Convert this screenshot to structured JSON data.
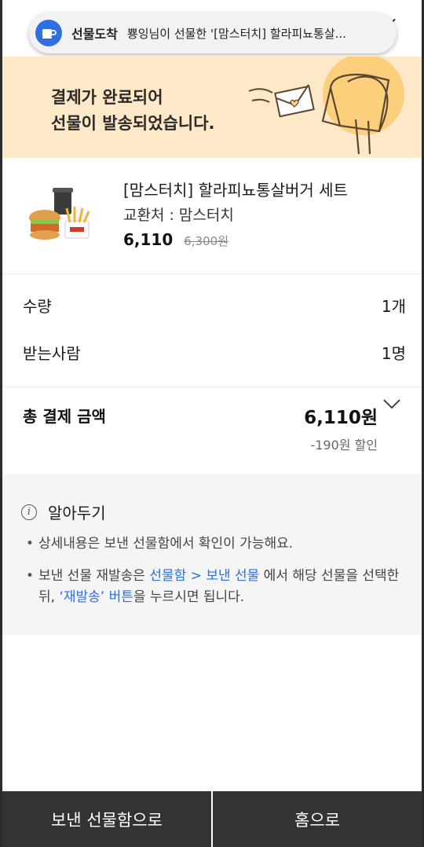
{
  "toast": {
    "icon": "gift-cup-icon",
    "title": "선물도착",
    "message": "뿅잉님이 선물한 '[맘스터치] 할라피뇨통살..."
  },
  "banner": {
    "line1": "결제가 완료되어",
    "line2": "선물이 발송되었습니다.",
    "illustration": "mailbox-envelope-illustration",
    "bg_color": "#fde8c8"
  },
  "product": {
    "name": "[맘스터치] 할라피뇨통살버거 세트",
    "shop": "교환처 : 맘스터치",
    "price": "6,110",
    "original_price": "6,300원"
  },
  "details": {
    "quantity_label": "수량",
    "quantity_value": "1개",
    "recipient_label": "받는사람",
    "recipient_value": "1명"
  },
  "total": {
    "label": "총 결제 금액",
    "amount": "6,110원",
    "discount": "-190원 할인"
  },
  "notice": {
    "title": "알아두기",
    "item1": "상세내용은 보낸 선물함에서 확인이 가능해요.",
    "item2_prefix": "보낸 선물 재발송은 ",
    "item2_link1": "선물함 > 보낸 선물",
    "item2_mid": " 에서 해당 선물을 선택한뒤, ",
    "item2_link2": "‘재발송’ 버튼",
    "item2_suffix": "을 누르시면 됩니다.",
    "link_color": "#2f6fe0"
  },
  "buttons": {
    "sent_box": "보낸 선물함으로",
    "home": "홈으로"
  }
}
